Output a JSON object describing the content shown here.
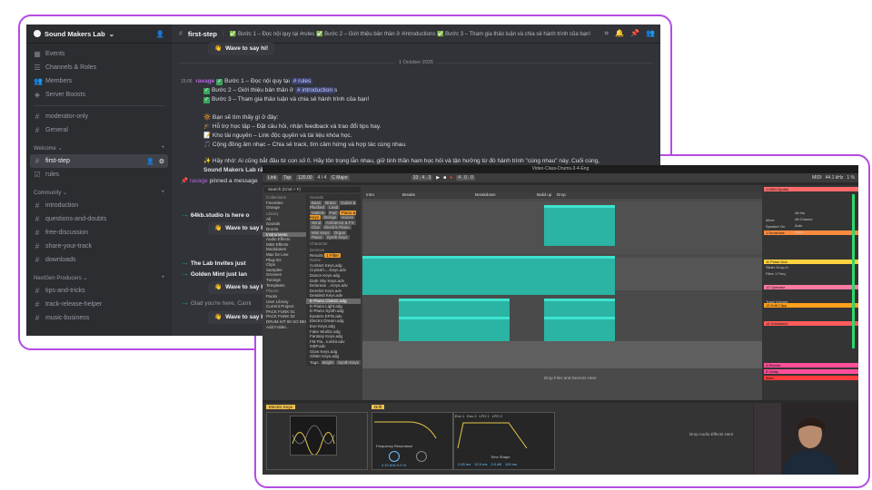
{
  "discord": {
    "server_name": "Sound Makers Lab",
    "channel": "first-step",
    "topic": "✅ Bước 1 – Đọc nội quy tại #rules ✅ Bước 2 – Giới thiệu bản thân ở #introductions ✅ Bước 3 – Tham gia thảo luận và chia sẻ hành trình của bạn!",
    "nav": [
      "Events",
      "Channels & Roles",
      "Members",
      "Server Boosts"
    ],
    "channels_top": [
      "moderator-only",
      "General"
    ],
    "cat_welcome": "Welcome",
    "welcome_channels": [
      "first-step",
      "rules"
    ],
    "cat_community": "Community",
    "community_channels": [
      "introduction",
      "questions-and-doubts",
      "free-discussion",
      "share-your-track",
      "downloads"
    ],
    "cat_nextgen": "NextGen Producers",
    "nextgen_channels": [
      "tips-and-tricks",
      "track-release-helper",
      "music-business"
    ],
    "wave_label": "Wave to say hi!",
    "date_divider": "1 October 2025",
    "msg_time": "15:06",
    "msg_author": "ravage",
    "msg_line1": "Bước 1 – Đọc nội quy tại",
    "msg_line1_mention": "# rules",
    "msg_line2": "Bước 2 – Giới thiệu bản thân ở",
    "msg_line2_mention": "# introduction",
    "msg_line2_tail": "s",
    "msg_line3": "Bước 3 – Tham gia thảo luận và chia sẻ hành trình của bạn!",
    "msg_see": "Bạn sẽ tìm thấy gì ở đây:",
    "msg_b1": "Hỗ trợ học tập – Đặt câu hỏi, nhận feedback và trao đổi tips hay.",
    "msg_b2": "Kho tài nguyên – Link độc quyền và tài liệu khóa học.",
    "msg_b3": "Cộng đồng âm nhạc – Chia sẻ track, tìm cảm hứng và hợp tác cùng nhau.",
    "msg_p1": "Hãy nhớ: Ai cũng bắt đầu từ con số 0. Hãy tôn trọng lẫn nhau, giữ tinh thần ham học hỏi và tận hưởng từ đó hành trình \"cùng nhau\" này. Cuối cùng,",
    "msg_p2": "Sound Makers Lab rất",
    "pinned_author": "ravage",
    "pinned_text": "pinned a message",
    "join1": "64kb.studio is here o",
    "join2": "The Lab Invites just",
    "join3": "Golden Mint just lan",
    "join4": "Glad you're here, Cami"
  },
  "ableton": {
    "title": "Video-Class-Drums-3-4-Eng",
    "tempo": "120.00",
    "time_sig": "4 / 4",
    "key": "C Major",
    "position": "33 . 4 . 3",
    "loop_end": "4 . 0 . 0",
    "cpu": "1 %",
    "midi_label": "MIDI",
    "sample_rate": "44.1 kHz",
    "browser_search": "Search (Cmd + F)",
    "collections_label": "Collections",
    "collections": [
      "Favorites",
      "Orange"
    ],
    "library_label": "Library",
    "library": [
      "All",
      "Sounds",
      "Drums",
      "Instruments",
      "Audio Effects",
      "MIDI Effects",
      "Modulators",
      "Max for Live",
      "Plug-Ins",
      "Clips",
      "Samples",
      "Grooves",
      "Tunings",
      "Templates"
    ],
    "places_label": "Places",
    "places": [
      "Packs",
      "User Library",
      "Current Project",
      "PACK FUNK 01",
      "PACK FUNK 02",
      "DRUM KIT 80 SO BEGI",
      "Add Folder..."
    ],
    "sounds_label": "Sounds",
    "sound_tags": [
      "Bass",
      "Brass",
      "Guitar & Plucked",
      "Lead",
      "Mallets",
      "Pad",
      "Piano & Keys",
      "Strings",
      "Voices",
      "Wind",
      "Ambience & FX"
    ],
    "sub_tags": [
      "Clav",
      "Electric Piano",
      "Mini Keys",
      "Organ",
      "Piano",
      "Synth Keys"
    ],
    "character_label": "Character",
    "devices_label": "Devices",
    "results_label": "Results",
    "results_filter": "1 Filter",
    "results_name": "Name",
    "results": [
      "Contact Keys.adg",
      "Crystal L...Keys.adv",
      "Dance Keys.adg",
      "Dark Sky Keys.adv",
      "Delorean ...Keys.adv",
      "Derelict Keys.adv",
      "Detailed Keys.adv",
      "E-Piano Classic.adg",
      "E-Piano Light.adg",
      "E-Piano Synth.adg",
      "Eastern EPiN.adv",
      "Electro Dream.adg",
      "Eve Keys.adg",
      "Fake Wurlitz.adg",
      "Fantasy Keys.adg",
      "FM Fla...rumkit.adv",
      "GBP.adv",
      "Glow Keys.adg",
      "Glitter Keys.adg"
    ],
    "tags_label": "Tags:",
    "tags": [
      "Bright",
      "Synth Keys"
    ],
    "sections": [
      "Intro",
      "Breaks",
      "Breakdown",
      "Build up",
      "Drop"
    ],
    "drop_hint": "Drop Files and Devices Here",
    "drop_audio": "Drop Audio Effects Here",
    "tracks": [
      {
        "name": "1 MIDI Synthe",
        "color": "#ff6b6b"
      },
      {
        "name": "1 Drumrack",
        "color": "#ff8a3d"
      },
      {
        "name": "11 Pulse Dub",
        "color": "#ffd23f"
      },
      {
        "name": "12 Operator",
        "color": "#ff7aa2"
      },
      {
        "name": "13 Drift Clipp",
        "color": "#ff9f1c"
      },
      {
        "name": "14 Substance",
        "color": "#ff5c5c"
      },
      {
        "name": "A Reverb",
        "color": "#ff4f9a"
      },
      {
        "name": "B Delay",
        "color": "#ff4f9a"
      },
      {
        "name": "Main",
        "color": "#ff3b3b"
      }
    ],
    "mixer_labels": [
      "Mixer",
      "Speaker On",
      "Slider Drop-In",
      "Filter 1 Freq",
      "Track Volume"
    ],
    "routing": [
      "All Ins",
      "All Channe",
      "Auto",
      "Main"
    ],
    "device_name": "Electric Keys",
    "synth_name": "Drift",
    "env_labels": [
      "Env 1",
      "Env 2",
      "LFO 1",
      "LFO 2",
      "Amp",
      "Env 3"
    ],
    "freq_label": "Frequency",
    "res_label": "Resonance",
    "freq_value": "2.10 kHz",
    "res_value": "0.0 %",
    "time_label": "Time",
    "shape_label": "Shape",
    "env_values": [
      "2.00 ms",
      "10.0 ms",
      "0.0 dB",
      "100 ms"
    ]
  }
}
